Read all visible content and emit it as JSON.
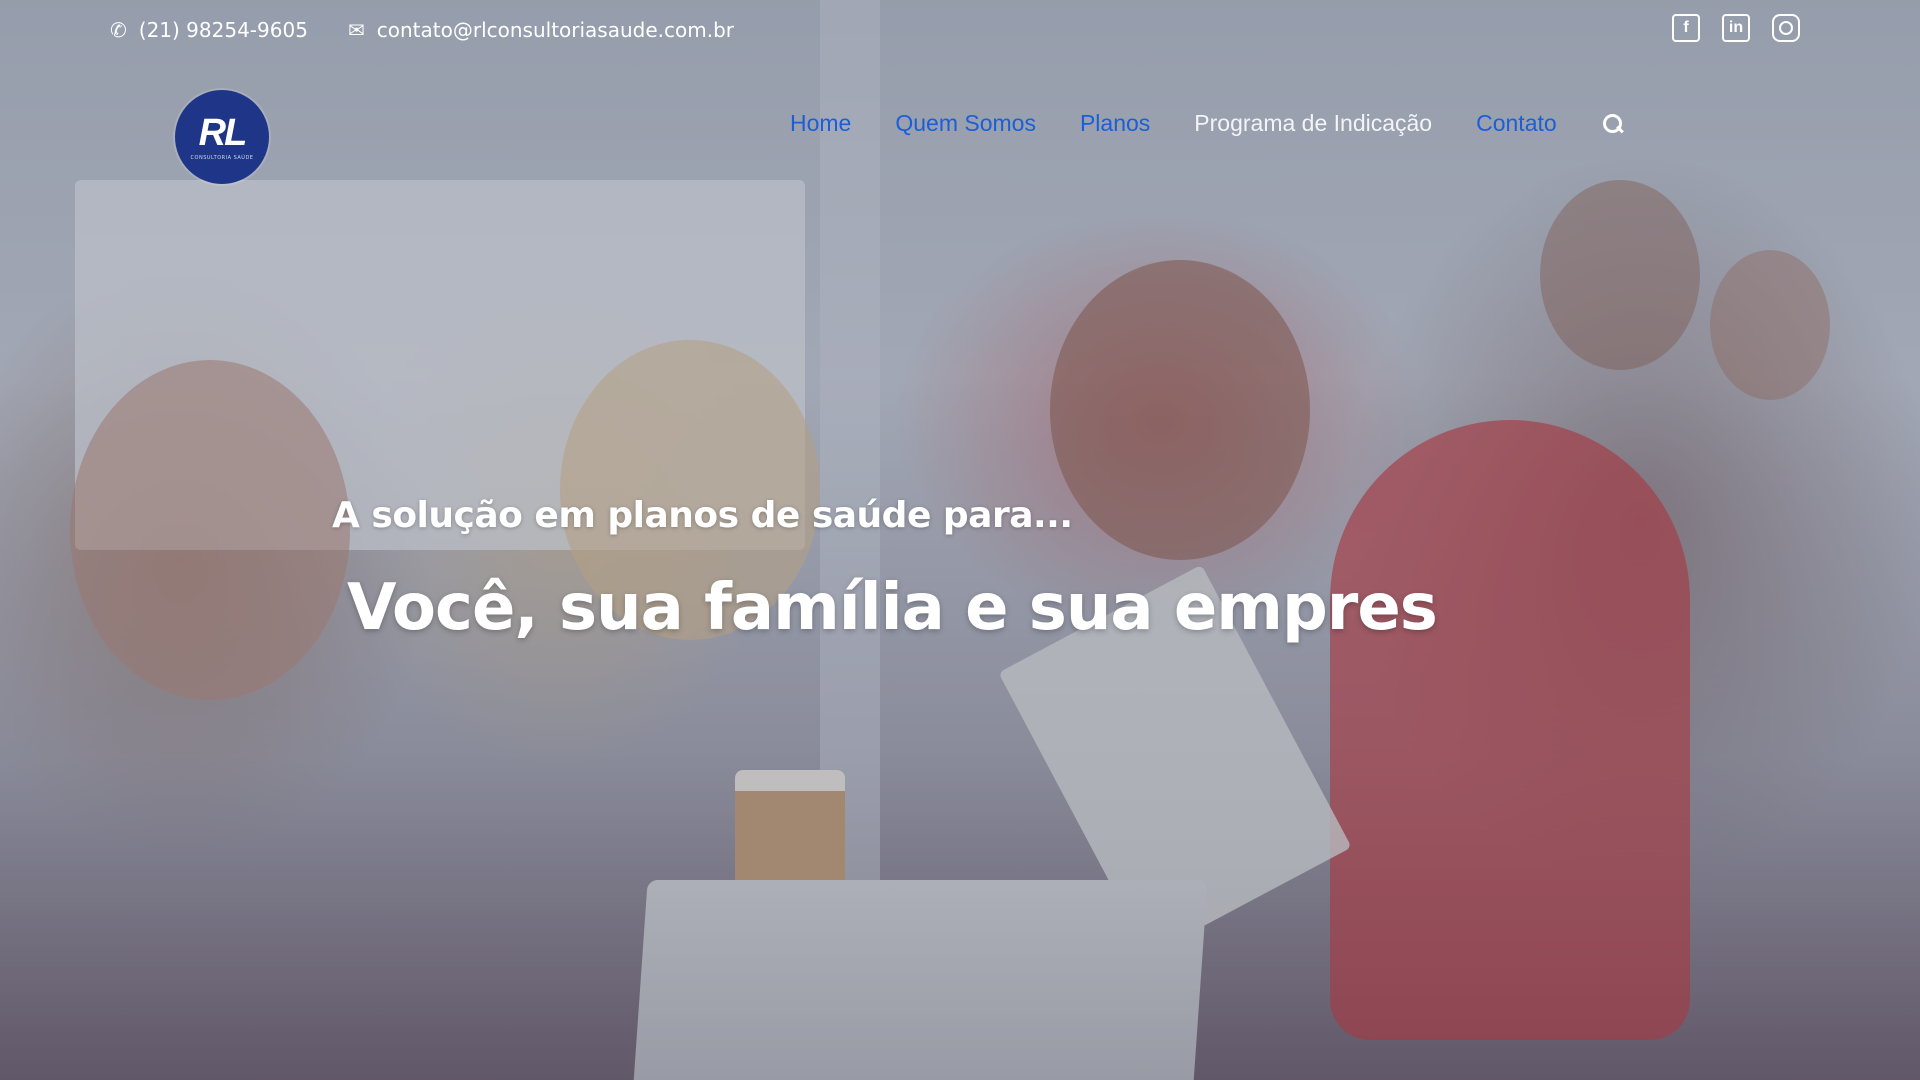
{
  "topbar": {
    "phone": "(21) 98254-9605",
    "email": "contato@rlconsultoriasaude.com.br",
    "phone_icon": "phone-icon",
    "email_icon": "envelope-icon"
  },
  "socials": [
    {
      "name": "facebook-icon",
      "glyph": "f"
    },
    {
      "name": "linkedin-icon",
      "glyph": "in"
    },
    {
      "name": "instagram-icon",
      "glyph": ""
    }
  ],
  "logo": {
    "text": "RL",
    "subtitle": "CONSULTORIA SAÚDE",
    "color": "#1f3688"
  },
  "nav": {
    "items": [
      "Home",
      "Quem Somos",
      "Planos",
      "Programa de Indicação",
      "Contato"
    ],
    "link_color": "#1b5fd8",
    "search_icon": "search-icon"
  },
  "hero": {
    "pre_title": "A solução em planos de saúde para...",
    "headline": "Você, sua família e sua empres"
  }
}
